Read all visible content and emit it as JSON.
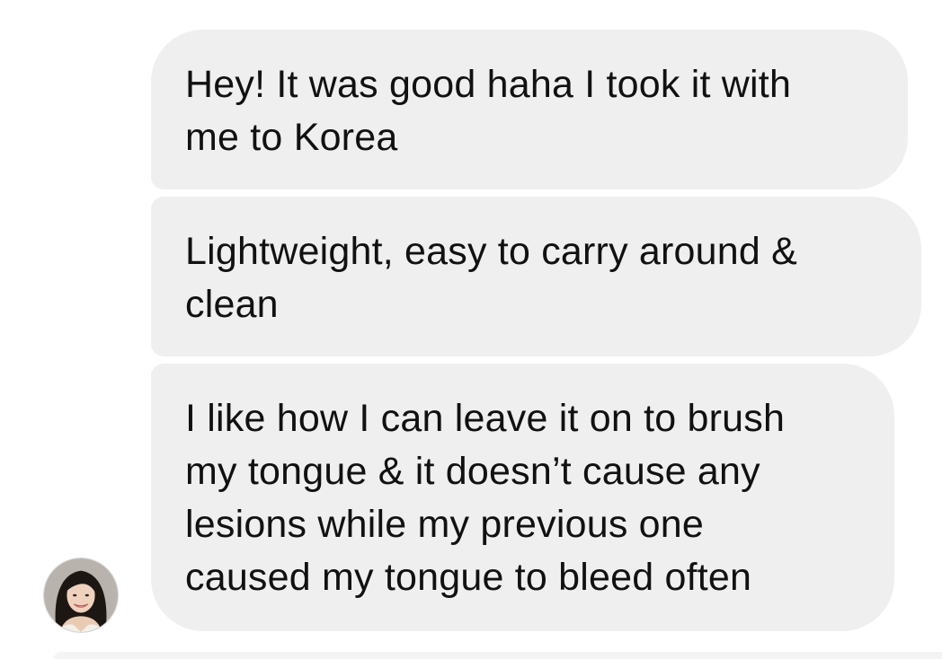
{
  "conversation": {
    "sender": {
      "avatar_icon": "user-avatar-photo"
    },
    "messages": [
      {
        "text": "Hey! It was good haha I took it with\nme to Korea"
      },
      {
        "text": "Lightweight, easy to carry around &\nclean"
      },
      {
        "text": "I like how I can leave it on to brush\nmy tongue & it doesn’t cause any\nlesions while my previous one\ncaused my tongue to bleed often"
      }
    ],
    "colors": {
      "bubble_background": "#efefef",
      "text": "#111111",
      "page_background": "#ffffff"
    }
  }
}
